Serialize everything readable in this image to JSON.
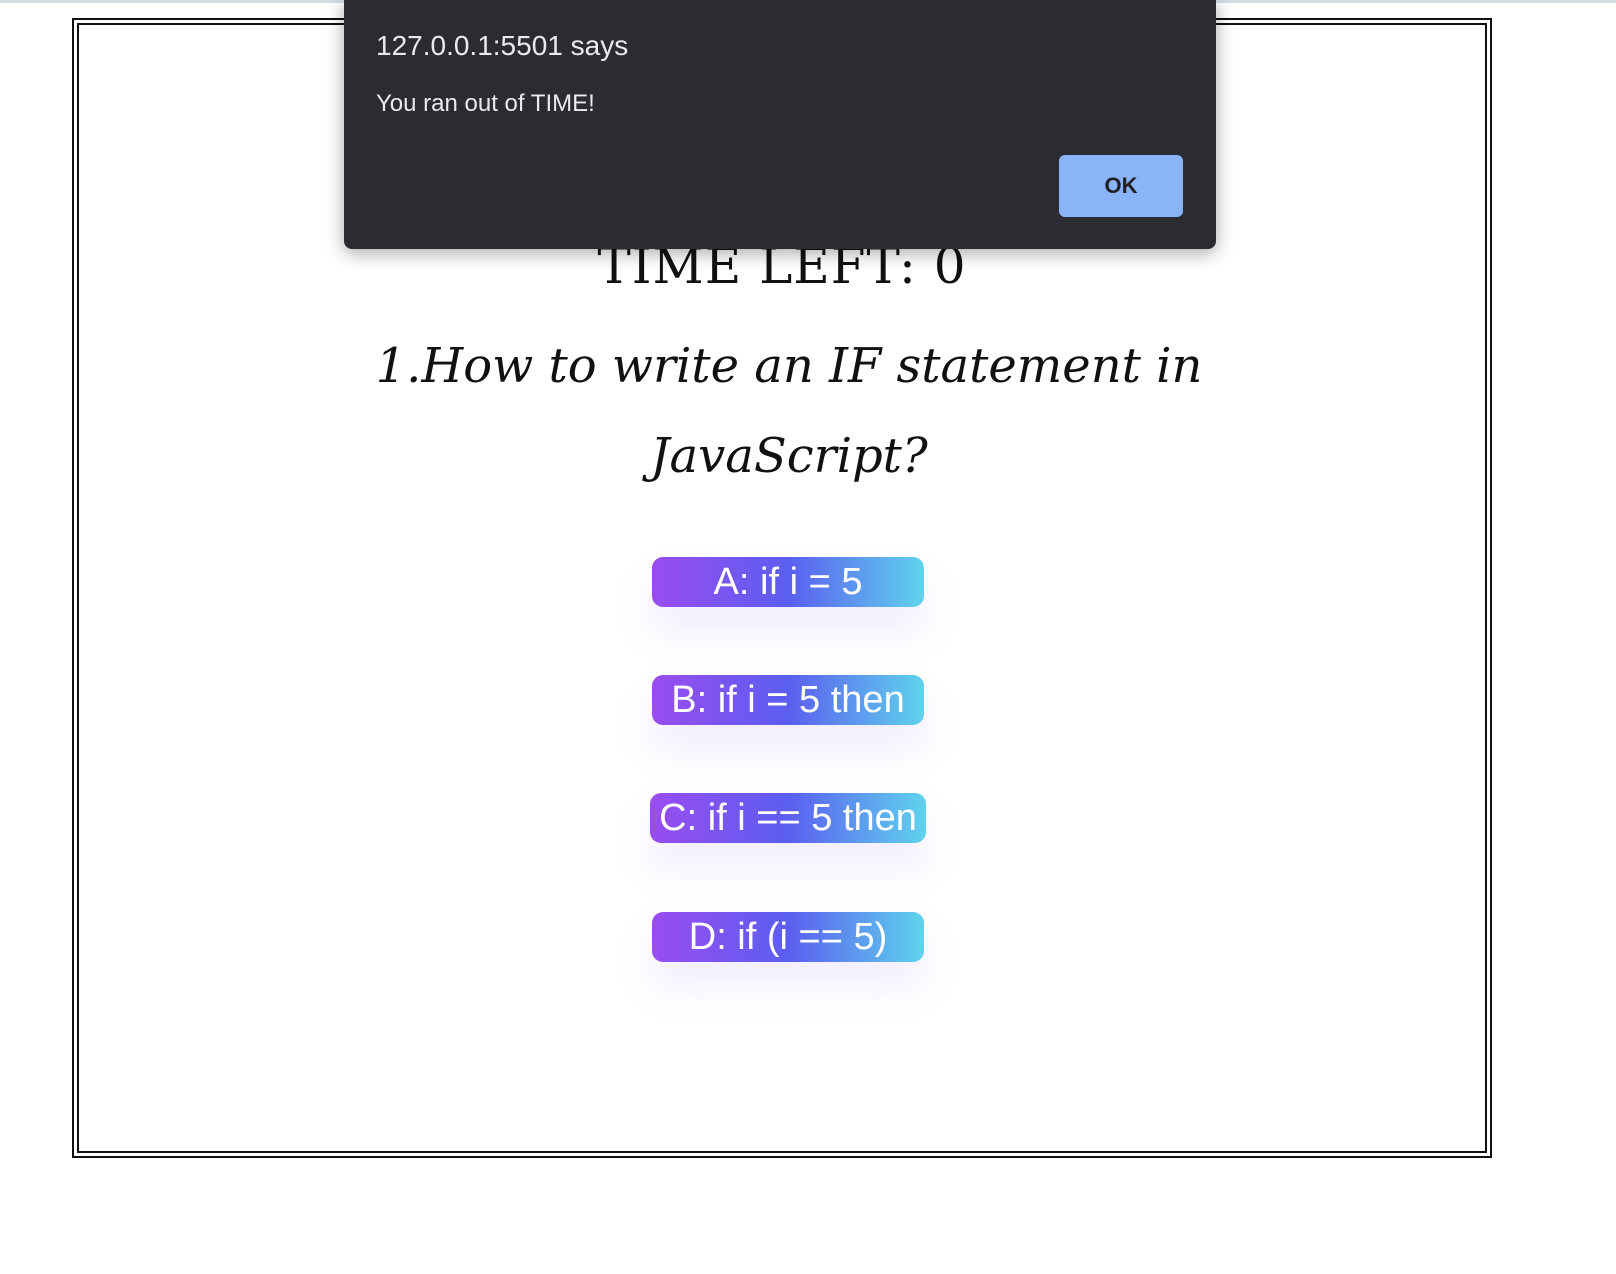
{
  "quiz": {
    "timer_text": "TIME LEFT: 0",
    "question": "1.How to write an IF statement in JavaScript?",
    "answers": [
      "A: if i = 5",
      "B: if i = 5 then",
      "C: if i == 5 then",
      "D: if (i == 5)"
    ]
  },
  "alert_dialog": {
    "origin": "127.0.0.1:5501 says",
    "message": "You ran out of TIME!",
    "ok_label": "OK"
  },
  "colors": {
    "dialog_bg": "#2b2c31",
    "ok_button_bg": "#8ab4f8",
    "answer_gradient_start": "#9a4cf0",
    "answer_gradient_mid": "#5b5ef0",
    "answer_gradient_end": "#5fd3ec"
  }
}
